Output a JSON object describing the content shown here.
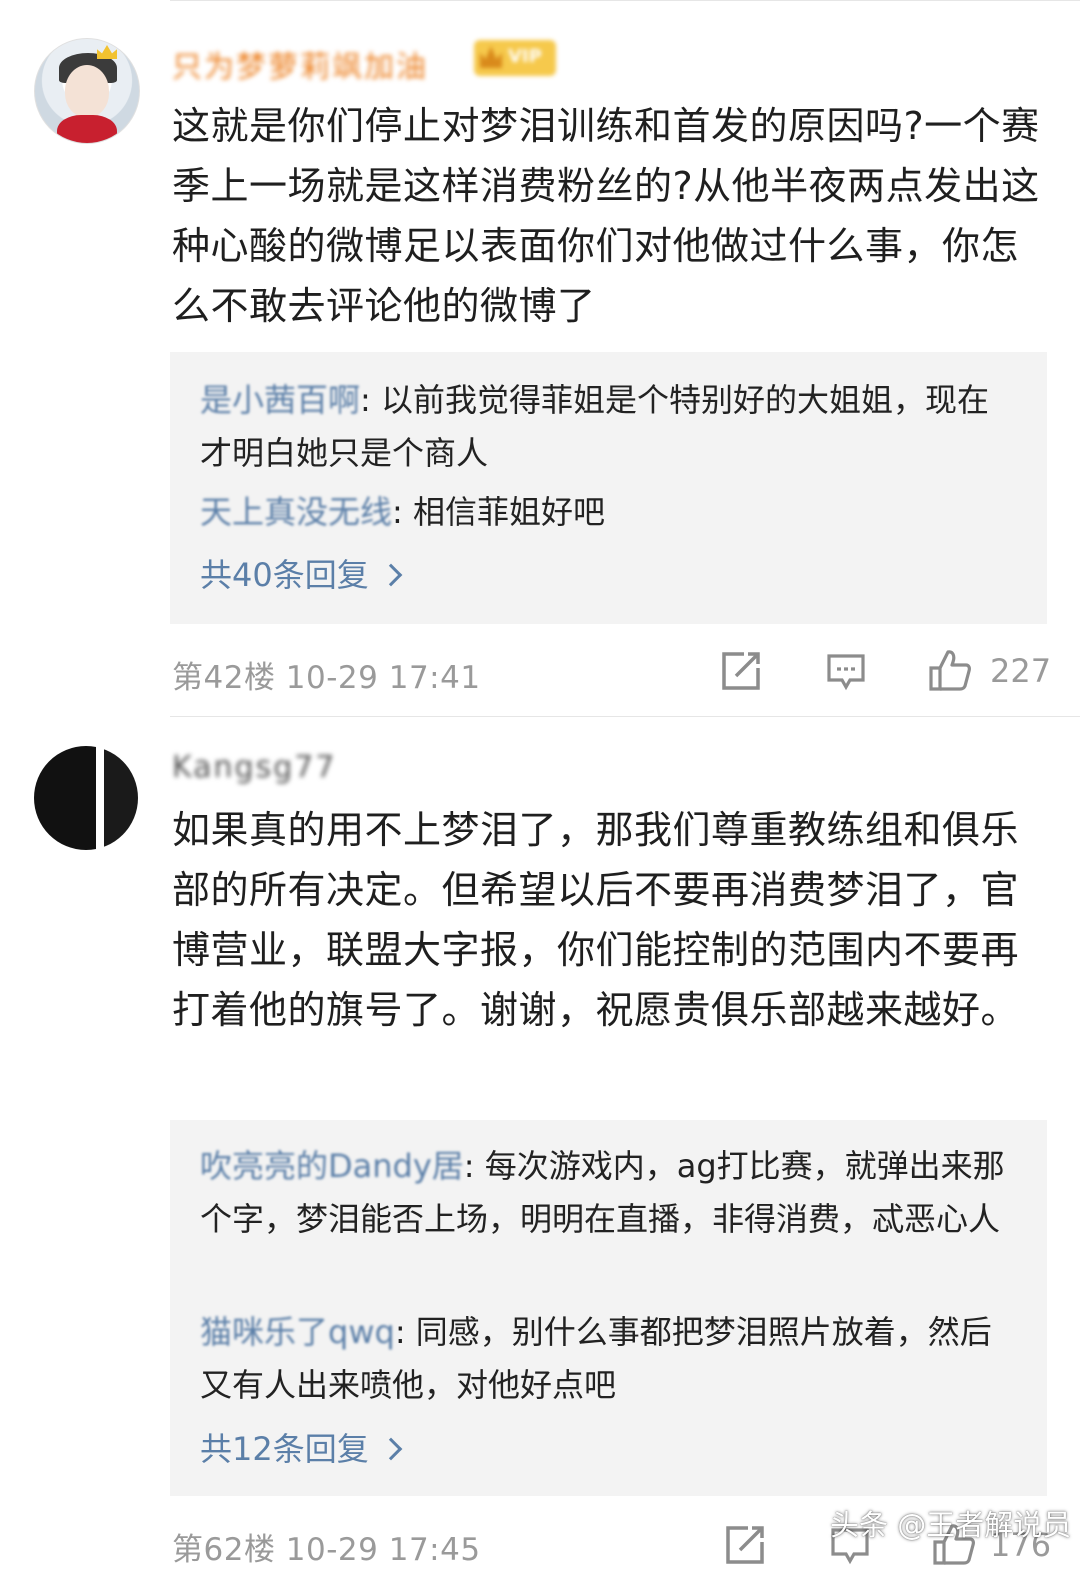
{
  "comments": [
    {
      "username": "只为梦萝莉飒加油",
      "vip_badge": "VIP",
      "body": "这就是你们停止对梦泪训练和首发的原因吗?一个赛季上一场就是这样消费粉丝的?从他半夜两点发出这种心酸的微博足以表面你们对他做过什么事，你怎么不敢去评论他的微博了",
      "replies": [
        {
          "name": "是小茜百啊",
          "text": ": 以前我觉得菲姐是个特别好的大姐姐，现在才明白她只是个商人"
        },
        {
          "name": "天上真没无线",
          "text": ": 相信菲姐好吧"
        }
      ],
      "more_replies": "共40条回复",
      "floor_time": "第42楼  10-29 17:41",
      "likes": "227"
    },
    {
      "username": "Kangsg77",
      "body": "如果真的用不上梦泪了，那我们尊重教练组和俱乐部的所有决定。但希望以后不要再消费梦泪了，官博营业，联盟大字报，你们能控制的范围内不要再打着他的旗号了。谢谢，祝愿贵俱乐部越来越好。",
      "replies": [
        {
          "name": "吹亮亮的Dandy居",
          "text": ": 每次游戏内，ag打比赛，就弹出来那个字，梦泪能否上场，明明在直播，非得消费，忒恶心人"
        },
        {
          "name": "猫咪乐了qwq",
          "text": ": 同感，别什么事都把梦泪照片放着，然后又有人出来喷他，对他好点吧"
        }
      ],
      "more_replies": "共12条回复",
      "floor_time": "第62楼  10-29 17:45",
      "likes": "176"
    }
  ],
  "icons": [
    "repost-icon",
    "comment-icon",
    "like-icon"
  ],
  "watermark": "头条 @王者解说员",
  "colors": {
    "link": "#5b7fa8",
    "vip_name": "#ec7f1f",
    "meta": "#9a9a9a",
    "reply_bg": "#f3f3f3"
  }
}
